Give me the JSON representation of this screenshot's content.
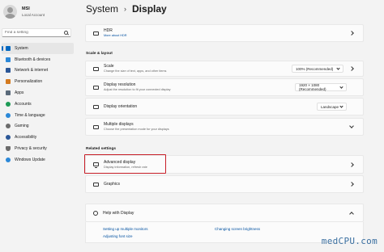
{
  "profile": {
    "name": "MSI",
    "account": "Local Account"
  },
  "search": {
    "placeholder": "Find a setting"
  },
  "nav": [
    {
      "label": "System",
      "icon": "system-icon",
      "color": "#0067c0",
      "active": true
    },
    {
      "label": "Bluetooth & devices",
      "icon": "bluetooth-icon",
      "color": "#2b88d8"
    },
    {
      "label": "Network & internet",
      "icon": "network-icon",
      "color": "#2b5797"
    },
    {
      "label": "Personalization",
      "icon": "brush-icon",
      "color": "#d47a1f"
    },
    {
      "label": "Apps",
      "icon": "apps-icon",
      "color": "#5a6a7a"
    },
    {
      "label": "Accounts",
      "icon": "accounts-icon",
      "color": "#1e9b56"
    },
    {
      "label": "Time & language",
      "icon": "clock-icon",
      "color": "#2b88d8"
    },
    {
      "label": "Gaming",
      "icon": "gaming-icon",
      "color": "#6b6b6b"
    },
    {
      "label": "Accessibility",
      "icon": "accessibility-icon",
      "color": "#2b5797"
    },
    {
      "label": "Privacy & security",
      "icon": "shield-icon",
      "color": "#6b6b6b"
    },
    {
      "label": "Windows Update",
      "icon": "update-icon",
      "color": "#2b88d8"
    }
  ],
  "header": {
    "crumb": "System",
    "current": "Display"
  },
  "hdr": {
    "title": "HDR",
    "link": "More about HDR"
  },
  "scale_section": "Scale & layout",
  "scale": {
    "title": "Scale",
    "sub": "Change the size of text, apps, and other items",
    "value": "100% (Recommended)"
  },
  "resolution": {
    "title": "Display resolution",
    "sub": "Adjust the resolution to fit your connected display",
    "value": "1920 × 1080 (Recommended)"
  },
  "orientation": {
    "title": "Display orientation",
    "value": "Landscape"
  },
  "multiple": {
    "title": "Multiple displays",
    "sub": "Choose the presentation mode for your displays"
  },
  "related_section": "Related settings",
  "advanced": {
    "title": "Advanced display",
    "sub": "Display information, refresh rate"
  },
  "graphics": {
    "title": "Graphics"
  },
  "help": {
    "title": "Help with Display",
    "links": [
      "Setting up multiple monitors",
      "Changing screen brightness",
      "Adjusting font size"
    ]
  },
  "watermark": "medCPU.com",
  "colors": {
    "accent": "#0067c0",
    "highlight_box": "#c81e28"
  }
}
